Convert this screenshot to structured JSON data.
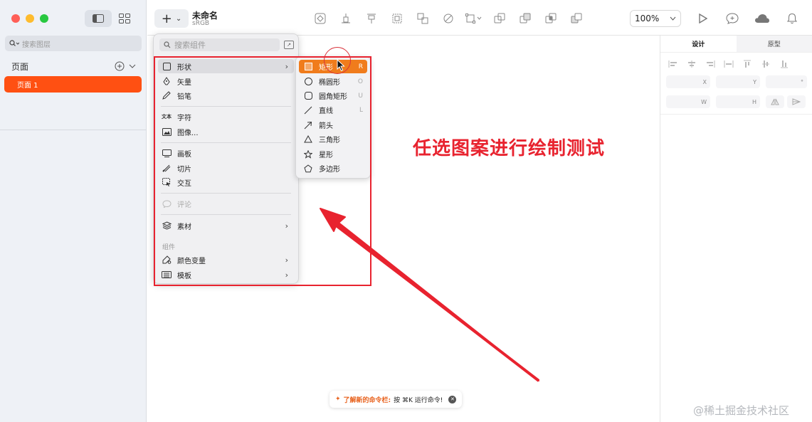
{
  "sidebar": {
    "search_placeholder": "搜索图层",
    "pages_header": "页面",
    "pages": [
      "页面 1"
    ]
  },
  "toolbar": {
    "doc_title": "未命名",
    "doc_colorspace": "sRGB",
    "zoom": "100%"
  },
  "insert_menu": {
    "search_placeholder": "搜索组件",
    "items": [
      {
        "label": "形状",
        "icon": "square-icon"
      },
      {
        "label": "矢量",
        "icon": "pen-icon"
      },
      {
        "label": "铅笔",
        "icon": "pencil-icon"
      },
      {
        "label": "字符",
        "icon": "text-icon",
        "icon_text": "文本"
      },
      {
        "label": "图像...",
        "icon": "image-icon"
      },
      {
        "label": "画板",
        "icon": "artboard-icon"
      },
      {
        "label": "切片",
        "icon": "slice-icon"
      },
      {
        "label": "交互",
        "icon": "hotspot-icon"
      },
      {
        "label": "评论",
        "icon": "comment-icon"
      },
      {
        "label": "素材",
        "icon": "layers-icon"
      },
      {
        "label": "颜色变量",
        "icon": "color-variable-icon"
      },
      {
        "label": "模板",
        "icon": "template-icon"
      }
    ],
    "group_label": "组件"
  },
  "shapes_submenu": {
    "items": [
      {
        "label": "矩形",
        "shortcut": "R"
      },
      {
        "label": "椭圆形",
        "shortcut": "O"
      },
      {
        "label": "圆角矩形",
        "shortcut": "U"
      },
      {
        "label": "直线",
        "shortcut": "L"
      },
      {
        "label": "箭头",
        "shortcut": ""
      },
      {
        "label": "三角形",
        "shortcut": ""
      },
      {
        "label": "星形",
        "shortcut": ""
      },
      {
        "label": "多边形",
        "shortcut": ""
      }
    ]
  },
  "right_panel": {
    "tab_design": "设计",
    "tab_prototype": "原型",
    "field_x": "X",
    "field_y": "Y",
    "field_rotation": "°",
    "field_w": "W",
    "field_h": "H"
  },
  "annotation": {
    "text": "任选图案进行绘制测试"
  },
  "tip": {
    "highlight": "了解新的命令栏:",
    "text": "按 ⌘K 运行命令!"
  },
  "watermark": "@稀土掘金技术社区",
  "colors": {
    "accent": "#ff5012",
    "selection": "#f07c1c",
    "annotation_red": "#e8232f"
  }
}
